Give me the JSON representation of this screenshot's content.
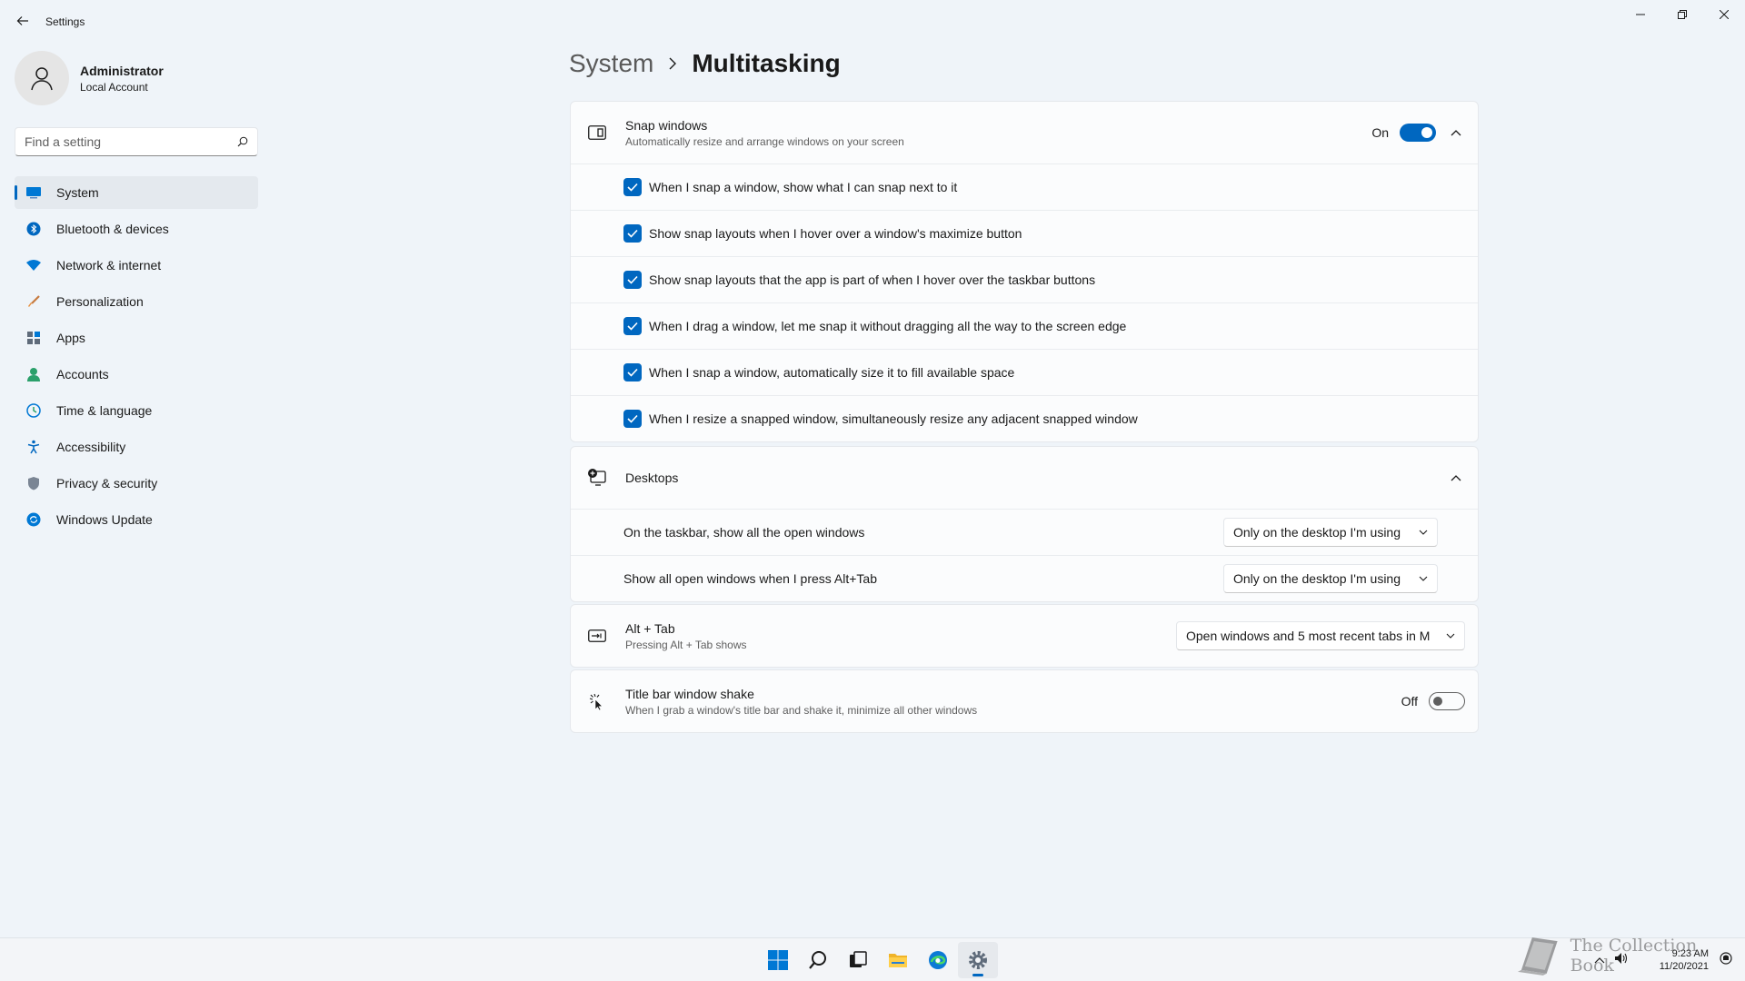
{
  "window": {
    "title": "Settings"
  },
  "profile": {
    "name": "Administrator",
    "account_type": "Local Account"
  },
  "search": {
    "placeholder": "Find a setting"
  },
  "nav": {
    "items": [
      {
        "label": "System",
        "icon": "monitor-icon",
        "active": true
      },
      {
        "label": "Bluetooth & devices",
        "icon": "bluetooth-icon"
      },
      {
        "label": "Network & internet",
        "icon": "wifi-icon"
      },
      {
        "label": "Personalization",
        "icon": "brush-icon"
      },
      {
        "label": "Apps",
        "icon": "apps-icon"
      },
      {
        "label": "Accounts",
        "icon": "person-icon"
      },
      {
        "label": "Time & language",
        "icon": "globe-clock-icon"
      },
      {
        "label": "Accessibility",
        "icon": "accessibility-icon"
      },
      {
        "label": "Privacy & security",
        "icon": "shield-icon"
      },
      {
        "label": "Windows Update",
        "icon": "update-icon"
      }
    ]
  },
  "breadcrumb": {
    "parent": "System",
    "current": "Multitasking"
  },
  "snap": {
    "title": "Snap windows",
    "description": "Automatically resize and arrange windows on your screen",
    "toggle_label": "On",
    "options": [
      "When I snap a window, show what I can snap next to it",
      "Show snap layouts when I hover over a window's maximize button",
      "Show snap layouts that the app is part of when I hover over the taskbar buttons",
      "When I drag a window, let me snap it without dragging all the way to the screen edge",
      "When I snap a window, automatically size it to fill available space",
      "When I resize a snapped window, simultaneously resize any adjacent snapped window"
    ]
  },
  "desktops": {
    "title": "Desktops",
    "rows": [
      {
        "label": "On the taskbar, show all the open windows",
        "value": "Only on the desktop I'm using"
      },
      {
        "label": "Show all open windows when I press Alt+Tab",
        "value": "Only on the desktop I'm using"
      }
    ]
  },
  "alttab": {
    "title": "Alt + Tab",
    "description": "Pressing Alt + Tab shows",
    "value": "Open windows and 5 most recent tabs in M"
  },
  "shake": {
    "title": "Title bar window shake",
    "description": "When I grab a window's title bar and shake it, minimize all other windows",
    "toggle_label": "Off"
  },
  "taskbar": {
    "clock_time": "9:23 AM",
    "clock_date": "11/20/2021",
    "watermark": "The Collection Book"
  },
  "colors": {
    "accent": "#0067c0",
    "background": "#eff4f9",
    "card": "#fbfcfd"
  }
}
